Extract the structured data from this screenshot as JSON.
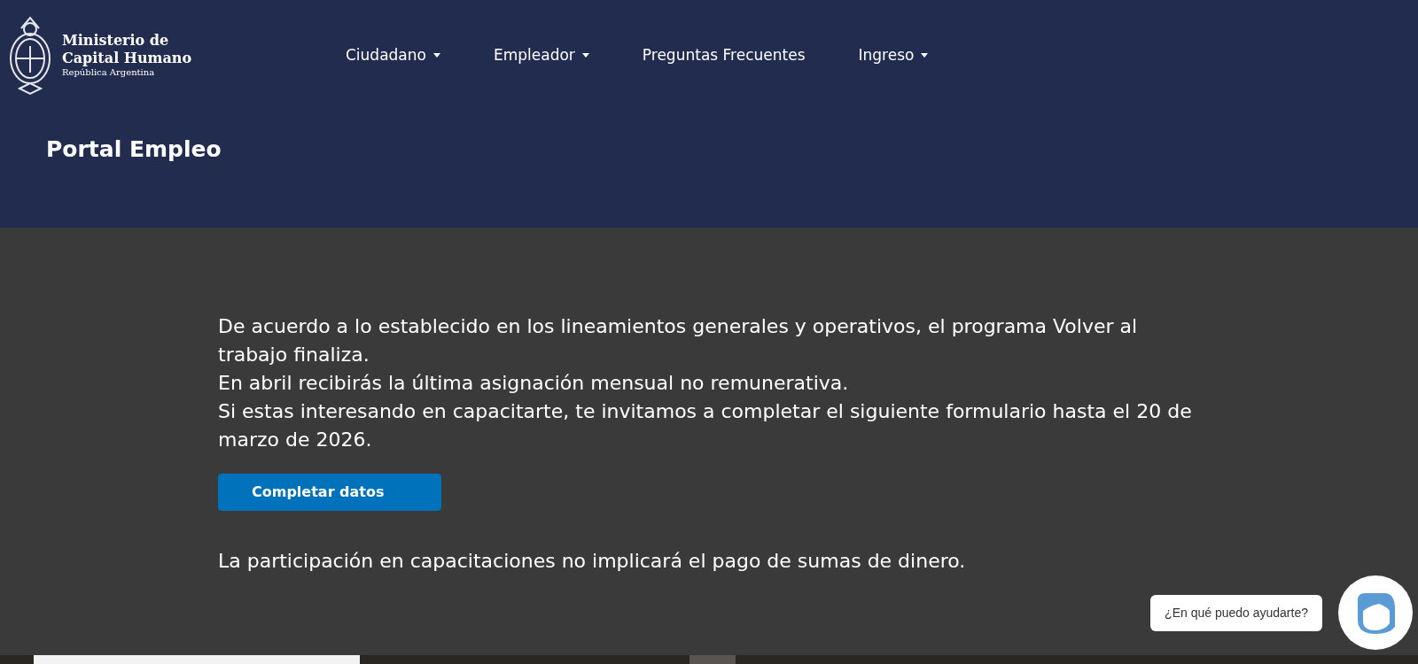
{
  "header": {
    "logo": {
      "line_1": "Ministerio de",
      "line_2": "Capital Humano",
      "line_3": "República Argentina"
    },
    "nav": [
      {
        "label": "Ciudadano",
        "dropdown": true
      },
      {
        "label": "Empleador",
        "dropdown": true
      },
      {
        "label": "Preguntas Frecuentes",
        "dropdown": false
      },
      {
        "label": "Ingreso",
        "dropdown": true
      }
    ],
    "page_title": "Portal Empleo"
  },
  "notice": {
    "paragraphs": [
      "De acuerdo a lo establecido en los lineamientos generales y operativos, el programa Volver al trabajo finaliza.",
      "En abril recibirás la última asignación mensual no remunerativa.",
      "Si estas interesando en capacitarte, te invitamos a completar el siguiente formulario hasta el 20 de marzo de 2026."
    ],
    "button": "Completar datos",
    "footnote": "La participación en capacitaciones no implicará el pago de sumas de dinero."
  },
  "chat": {
    "bubble": "¿En qué puedo ayudarte?"
  }
}
